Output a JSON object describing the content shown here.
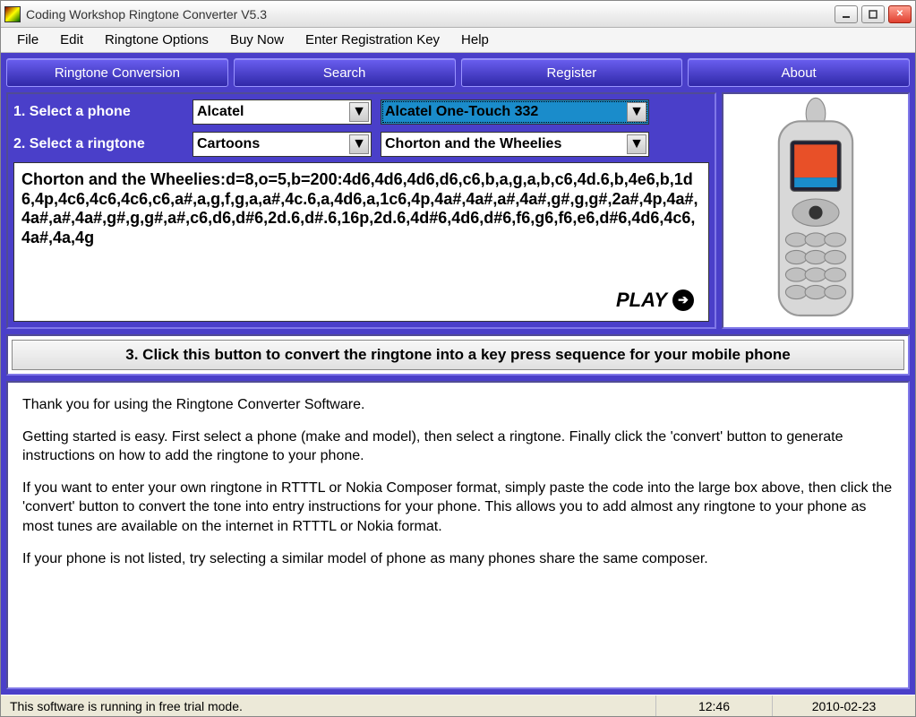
{
  "window": {
    "title": "Coding Workshop Ringtone Converter V5.3"
  },
  "menubar": {
    "items": [
      "File",
      "Edit",
      "Ringtone Options",
      "Buy Now",
      "Enter Registration Key",
      "Help"
    ]
  },
  "tabs": {
    "items": [
      "Ringtone Conversion",
      "Search",
      "Register",
      "About"
    ]
  },
  "selectors": {
    "phone_label": "1. Select a phone",
    "phone_brand": "Alcatel",
    "phone_model": "Alcatel One-Touch 332",
    "ringtone_label": "2. Select a ringtone",
    "ringtone_category": "Cartoons",
    "ringtone_name": "Chorton and the Wheelies"
  },
  "rtttl": {
    "code": "Chorton and the Wheelies:d=8,o=5,b=200:4d6,4d6,4d6,d6,c6,b,a,g,a,b,c6,4d.6,b,4e6,b,1d6,4p,4c6,4c6,4c6,c6,a#,a,g,f,g,a,a#,4c.6,a,4d6,a,1c6,4p,4a#,4a#,a#,4a#,g#,g,g#,2a#,4p,4a#,4a#,a#,4a#,g#,g,g#,a#,c6,d6,d#6,2d.6,d#.6,16p,2d.6,4d#6,4d6,d#6,f6,g6,f6,e6,d#6,4d6,4c6,4a#,4a,4g",
    "play_label": "PLAY"
  },
  "convert": {
    "label": "3. Click this button to convert the ringtone into a key press sequence for your mobile phone"
  },
  "instructions": {
    "p1": "Thank you for using the Ringtone Converter Software.",
    "p2": "Getting started is easy.  First select a phone (make and model),  then select a ringtone.  Finally click the 'convert' button to generate instructions on how to add the ringtone to your phone.",
    "p3": "If you want to enter your own ringtone in RTTTL or Nokia Composer format, simply paste the code into the large box above,  then click the 'convert' button to convert the tone into entry instructions for your phone.  This allows you to add almost any ringtone to your phone as most tunes are available on the internet in RTTTL or Nokia format.",
    "p4": "If your phone is not listed,  try selecting a similar model of phone as many phones share the same composer."
  },
  "status": {
    "mode": "This software is running in free trial mode.",
    "time": "12:46",
    "date": "2010-02-23"
  }
}
